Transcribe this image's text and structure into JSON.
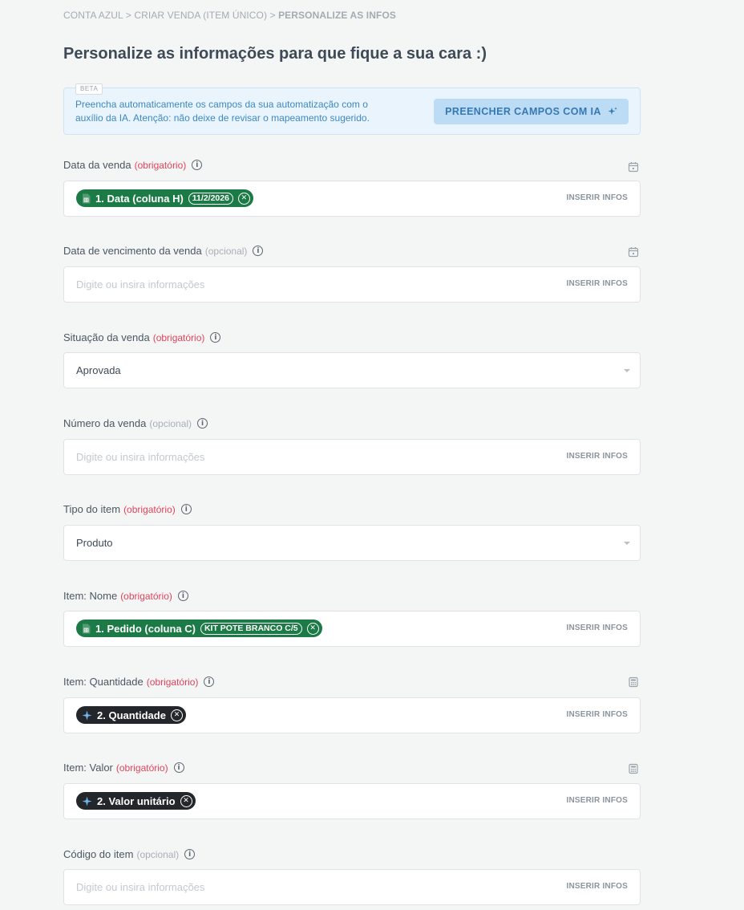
{
  "breadcrumb": {
    "part1": "CONTA AZUL",
    "part2": "CRIAR VENDA (ITEM ÚNICO)",
    "part3": "PERSONALIZE AS INFOS",
    "separator": ">"
  },
  "page_title": "Personalize as informações para que fique a sua cara :)",
  "ai_box": {
    "badge": "BETA",
    "text": "Preencha automaticamente os campos da sua automatização com o auxílio da IA. Atenção: não deixe de revisar o mapeamento sugerido.",
    "button": "PREENCHER CAMPOS COM IA"
  },
  "common": {
    "insert": "INSERIR INFOS",
    "placeholder": "Digite ou insira informações"
  },
  "fields": [
    {
      "label": "Data da venda",
      "tag": "(obrigatório)",
      "side_icon": "calendar-icon",
      "chip": {
        "text": "1. Data (coluna H)",
        "sub": "11/2/2026",
        "style": "sheet"
      }
    },
    {
      "label": "Data de vencimento da venda",
      "tag": "(opcional)",
      "side_icon": "calendar-icon"
    },
    {
      "label": "Situação da venda",
      "tag": "(obrigatório)",
      "value": "Aprovada",
      "select": true
    },
    {
      "label": "Número da venda",
      "tag": "(opcional)"
    },
    {
      "label": "Tipo do item",
      "tag": "(obrigatório)",
      "value": "Produto",
      "select": true
    },
    {
      "label": "Item: Nome",
      "tag": "(obrigatório)",
      "chip": {
        "text": "1. Pedido (coluna C)",
        "sub": "KIT POTE BRANCO C/5",
        "style": "sheet"
      }
    },
    {
      "label": "Item: Quantidade",
      "tag": "(obrigatório)",
      "side_icon": "calculator-icon",
      "chip": {
        "text": "2. Quantidade",
        "style": "ai"
      }
    },
    {
      "label": "Item: Valor",
      "tag": "(obrigatório)",
      "side_icon": "calculator-icon",
      "chip": {
        "text": "2. Valor unitário",
        "style": "ai"
      }
    },
    {
      "label": "Código do item",
      "tag": "(opcional)"
    }
  ],
  "colors": {
    "required": "#e2425a",
    "sheet_chip": "#1b7a45",
    "ai_chip": "#23272c",
    "ai_button": "#bcdcf6"
  }
}
